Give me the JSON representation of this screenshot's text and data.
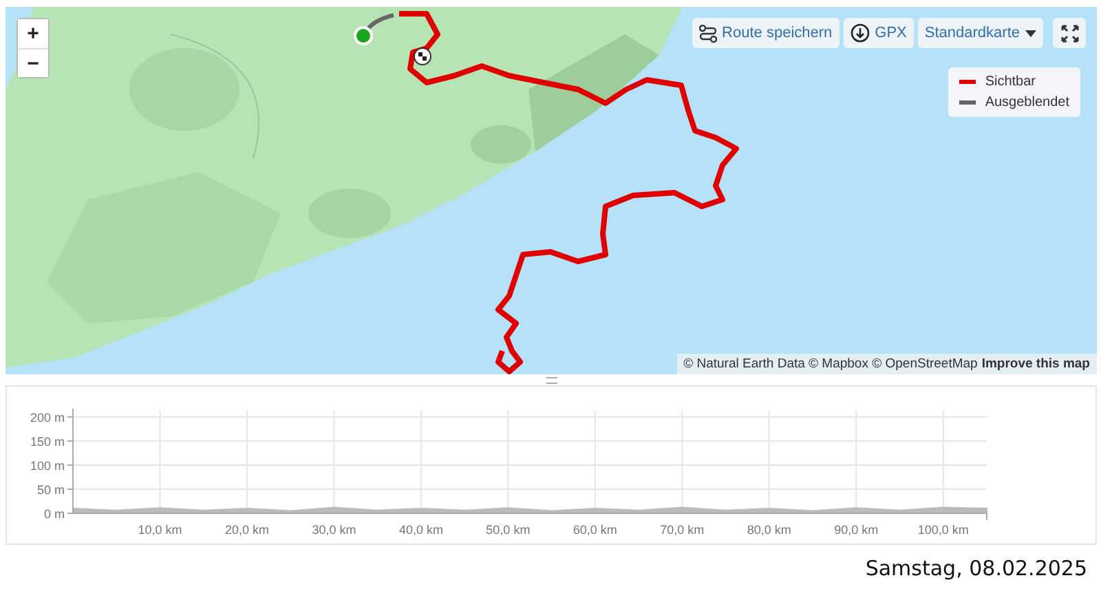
{
  "map": {
    "zoom_in": "+",
    "zoom_out": "−",
    "toolbar": [
      {
        "kind": "route",
        "label": "Route speichern"
      },
      {
        "kind": "download",
        "label": "GPX"
      },
      {
        "kind": "dropdown",
        "label": "Standardkarte"
      },
      {
        "kind": "fullscreen"
      }
    ],
    "legend": [
      {
        "label": "Sichtbar",
        "color": "#e00000"
      },
      {
        "label": "Ausgeblendet",
        "color": "#666666"
      }
    ],
    "attribution": "© Natural Earth Data © Mapbox © OpenStreetMap",
    "attribution_link": "Improve this map"
  },
  "elevation": {
    "chart_data": {
      "type": "area",
      "x": [
        0,
        5,
        10,
        15,
        20,
        25,
        30,
        35,
        40,
        45,
        50,
        55,
        60,
        65,
        70,
        75,
        80,
        85,
        90,
        95,
        100,
        105
      ],
      "series": [
        {
          "color": "#bbbbbb",
          "values": [
            10,
            6,
            11,
            6,
            10,
            5,
            12,
            6,
            10,
            6,
            11,
            5,
            10,
            6,
            12,
            6,
            10,
            5,
            11,
            6,
            12,
            10
          ]
        }
      ],
      "grid": true,
      "xlim": [
        0,
        105
      ],
      "ylim": [
        0,
        200
      ],
      "xticks": [
        {
          "value": 10,
          "label": "10,0 km"
        },
        {
          "value": 20,
          "label": "20,0 km"
        },
        {
          "value": 30,
          "label": "30,0 km"
        },
        {
          "value": 40,
          "label": "40,0 km"
        },
        {
          "value": 50,
          "label": "50,0 km"
        },
        {
          "value": 60,
          "label": "60,0 km"
        },
        {
          "value": 70,
          "label": "70,0 km"
        },
        {
          "value": 80,
          "label": "80,0 km"
        },
        {
          "value": 90,
          "label": "90,0 km"
        },
        {
          "value": 100,
          "label": "100,0 km"
        }
      ],
      "yticks": [
        {
          "value": 0,
          "label": "0 m"
        },
        {
          "value": 50,
          "label": "50 m"
        },
        {
          "value": 100,
          "label": "100 m"
        },
        {
          "value": 150,
          "label": "150 m"
        },
        {
          "value": 200,
          "label": "200 m"
        }
      ]
    }
  },
  "date": "Samstag, 08.02.2025"
}
